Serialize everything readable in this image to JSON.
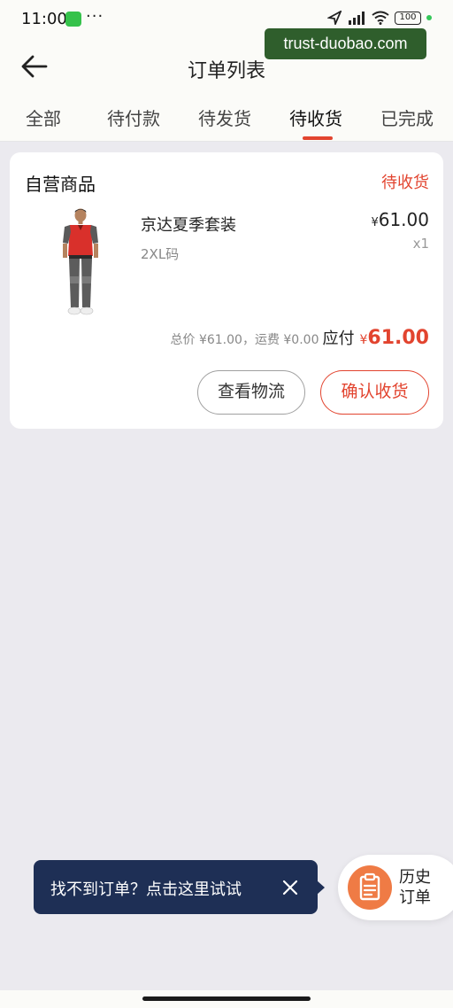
{
  "status_bar": {
    "time": "11:00",
    "dots": "···",
    "battery": "100"
  },
  "watermark": "trust-duobao.com",
  "header": {
    "title": "订单列表"
  },
  "tabs": [
    {
      "label": "全部"
    },
    {
      "label": "待付款"
    },
    {
      "label": "待发货"
    },
    {
      "label": "待收货",
      "active": true
    },
    {
      "label": "已完成"
    }
  ],
  "order": {
    "shop_name": "自营商品",
    "status": "待收货",
    "product": {
      "name": "京达夏季套装",
      "spec": "2XL码",
      "price_symbol": "¥",
      "price": "61.00",
      "qty": "x1"
    },
    "summary": {
      "detail": "总价 ¥61.00，运费 ¥0.00",
      "payable_label": "应付",
      "symbol": "¥",
      "amount": "61.00"
    },
    "buttons": {
      "logistics": "查看物流",
      "confirm": "确认收货"
    }
  },
  "tip": {
    "text": "找不到订单？点击这里试试"
  },
  "history": {
    "label": "历史订单"
  },
  "colors": {
    "accent": "#e2442f",
    "tip_bg": "#1e2f55",
    "history_icon": "#ef7b45",
    "page_bg": "#ebeaef"
  }
}
